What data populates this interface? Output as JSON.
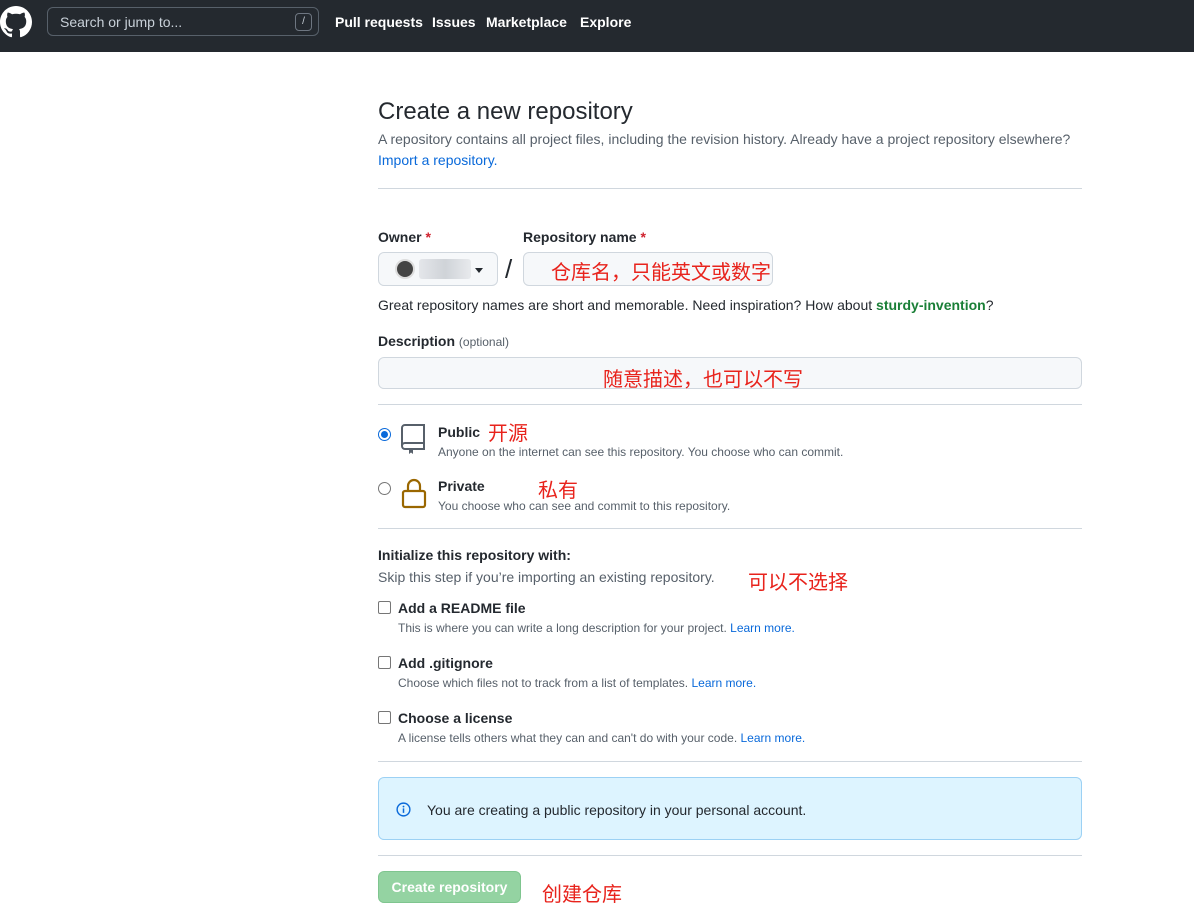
{
  "header": {
    "search_placeholder": "Search or jump to...",
    "search_shortcut": "/",
    "nav": [
      "Pull requests",
      "Issues",
      "Marketplace",
      "Explore"
    ]
  },
  "page": {
    "title": "Create a new repository",
    "subtitle": "A repository contains all project files, including the revision history. Already have a project repository elsewhere?",
    "import_link": "Import a repository."
  },
  "form": {
    "owner_label": "Owner",
    "required_mark": "*",
    "repo_name_label": "Repository name",
    "slash": "/",
    "name_hint_prefix": "Great repository names are short and memorable. Need inspiration? How about ",
    "name_suggestion": "sturdy-invention",
    "name_hint_suffix": "?",
    "description_label": "Description",
    "description_optional": "(optional)"
  },
  "visibility": {
    "public_title": "Public",
    "public_desc": "Anyone on the internet can see this repository. You choose who can commit.",
    "private_title": "Private",
    "private_desc": "You choose who can see and commit to this repository.",
    "selected": "public"
  },
  "init": {
    "title": "Initialize this repository with:",
    "subtitle": "Skip this step if you’re importing an existing repository.",
    "learn_more": "Learn more.",
    "options": [
      {
        "title": "Add a README file",
        "desc": "This is where you can write a long description for your project. "
      },
      {
        "title": "Add .gitignore",
        "desc": "Choose which files not to track from a list of templates. "
      },
      {
        "title": "Choose a license",
        "desc": "A license tells others what they can and can't do with your code. "
      }
    ]
  },
  "info": {
    "text": "You are creating a public repository in your personal account."
  },
  "submit": {
    "label": "Create repository"
  },
  "annotations": {
    "repo_name": "仓库名，只能英文或数字",
    "description": "随意描述，也可以不写",
    "public": "开源",
    "private": "私有",
    "init": "可以不选择",
    "create": "创建仓库"
  },
  "colors": {
    "header_bg": "#24292f",
    "link": "#0969da",
    "annotation": "#e8231c",
    "button": "#94d3a2",
    "info_bg": "#ddf4ff"
  }
}
